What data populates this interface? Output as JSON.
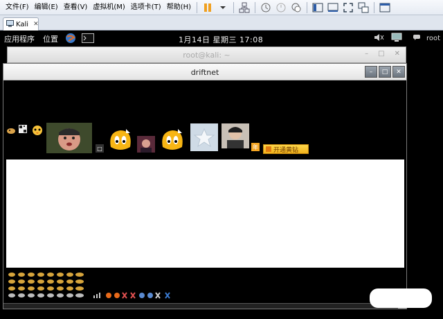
{
  "vmware": {
    "menu": [
      "文件(F)",
      "编辑(E)",
      "查看(V)",
      "虚拟机(M)",
      "选项卡(T)",
      "帮助(H)"
    ],
    "tab_label": "Kali"
  },
  "kali_panel": {
    "applications": "应用程序",
    "places": "位置",
    "clock": "1月14日 星期三 17:08",
    "user": "root"
  },
  "background_window": {
    "title": "root@kali: ~"
  },
  "driftnet_window": {
    "title": "driftnet",
    "ad_button_label": "开通黄钻"
  },
  "colors": {
    "menubar": "#e6ebf3",
    "panel": "#000000",
    "accent_orange": "#f5a623",
    "ad_yellow": "#f7c42b"
  }
}
